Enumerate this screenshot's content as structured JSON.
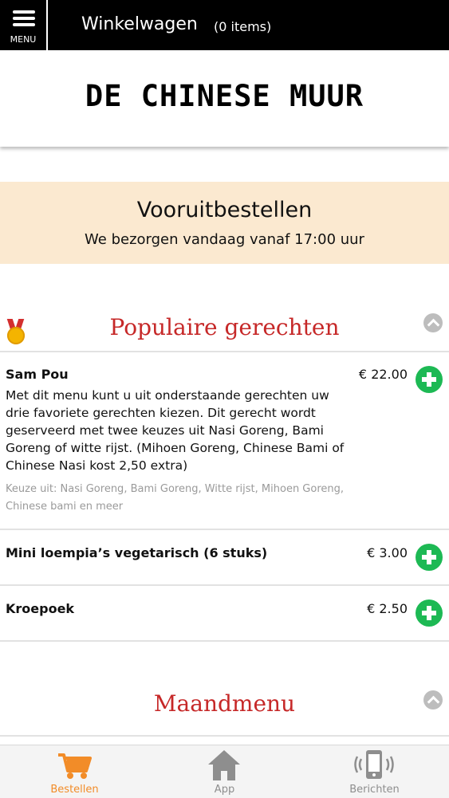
{
  "topbar": {
    "menu_label": "MENU",
    "cart_title": "Winkelwagen",
    "cart_count": "(0 items)"
  },
  "logo_text": "DE CHINESE MUUR",
  "preorder": {
    "title": "Vooruitbestellen",
    "subtitle": "We bezorgen vandaag vanaf 17:00 uur"
  },
  "categories": [
    {
      "title": "Populaire gerechten",
      "icon": "medal-icon",
      "items": [
        {
          "name": "Sam Pou",
          "price": "€ 22.00",
          "description": "Met dit menu kunt u uit onderstaande gerechten uw drie favoriete gerechten kiezen. Dit gerecht wordt geserveerd met twee keuzes uit Nasi Goreng, Bami Goreng of witte rijst. (Mihoen Goreng, Chinese Bami of Chinese Nasi kost 2,50 extra)",
          "choices": "Keuze uit: Nasi Goreng, Bami Goreng, Witte rijst, Mihoen Goreng, Chinese bami en meer"
        },
        {
          "name": "Mini loempia’s vegetarisch (6 stuks)",
          "price": "€ 3.00"
        },
        {
          "name": "Kroepoek",
          "price": "€ 2.50"
        }
      ]
    },
    {
      "title": "Maandmenu"
    }
  ],
  "bottom_nav": [
    {
      "label": "Bestellen",
      "icon": "cart-icon",
      "active": true
    },
    {
      "label": "App",
      "icon": "home-icon",
      "active": false
    },
    {
      "label": "Berichten",
      "icon": "phone-icon",
      "active": false
    }
  ],
  "colors": {
    "topbar_bg": "#000000",
    "accent_red": "#c62828",
    "add_green": "#1db954",
    "banner_bg": "#fbe9d0",
    "nav_active": "#f28c28",
    "nav_inactive": "#8e8e8e"
  }
}
